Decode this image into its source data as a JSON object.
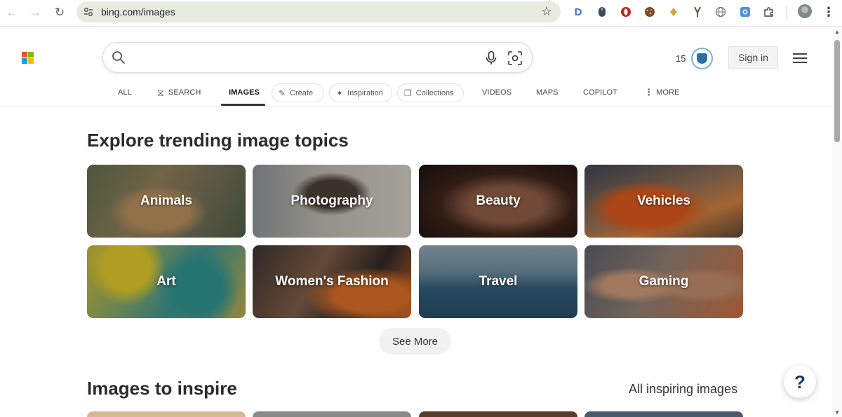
{
  "browser": {
    "url": "bing.com/images",
    "extensions": [
      "D",
      "mouse-icon",
      "opera-icon",
      "cookie-icon",
      "diamond-icon",
      "fork-icon",
      "globe-icon",
      "camera-ext-icon",
      "puzzle-icon"
    ]
  },
  "header": {
    "search_placeholder": "",
    "rewards_count": "15",
    "signin_label": "Sign in"
  },
  "tabs": {
    "all": "ALL",
    "search": "SEARCH",
    "images": "IMAGES",
    "create": "Create",
    "inspiration": "Inspiration",
    "collections": "Collections",
    "videos": "VIDEOS",
    "maps": "MAPS",
    "copilot": "COPILOT",
    "more": "MORE"
  },
  "trending": {
    "title": "Explore trending image topics",
    "topics": [
      "Animals",
      "Photography",
      "Beauty",
      "Vehicles",
      "Art",
      "Women's Fashion",
      "Travel",
      "Gaming"
    ],
    "see_more_label": "See More"
  },
  "inspire": {
    "title": "Images to inspire",
    "all_link": "All inspiring images"
  },
  "help": {
    "label": "?"
  },
  "colors": {
    "accent": "#2e6fa3",
    "omnibox_bg": "#e6ecdf"
  }
}
